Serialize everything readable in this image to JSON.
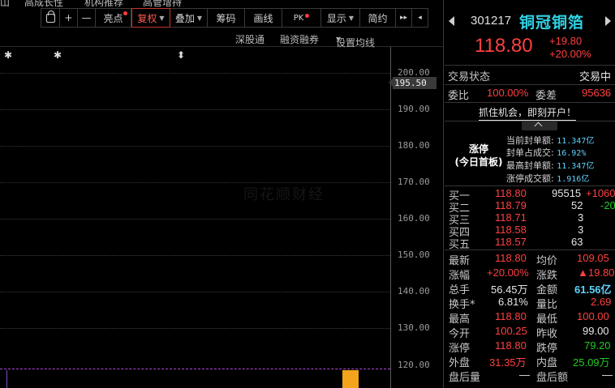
{
  "top_tabs": [
    "山",
    "高成长性",
    "机构推荐",
    "高管增持"
  ],
  "toolbar": {
    "lock_icon": "lock-icon",
    "plus": "+",
    "minus": "—",
    "highlight": "亮点",
    "adjust": "复权",
    "overlay": "叠加",
    "chips": "筹码",
    "draw": "画线",
    "pk": "PK",
    "display": "显示",
    "simple": "简约",
    "expand": "▸▸",
    "collapse": "◂"
  },
  "subbar": {
    "connect": "深股通",
    "margin": "融资融券",
    "ma_settings": "设置均线"
  },
  "chart_markers": [
    "✱",
    "✱",
    "⬍"
  ],
  "price_axis": {
    "ticks": [
      "200.00",
      "190.00",
      "180.00",
      "170.00",
      "160.00",
      "150.00",
      "140.00",
      "130.00",
      "120.00"
    ],
    "current": "195.50"
  },
  "watermark": "同花顺财经",
  "quote": {
    "code": "301217",
    "name": "铜冠铜箔",
    "price": "118.80",
    "change": "+19.80",
    "change_pct": "+20.00%",
    "status_label": "交易状态",
    "status_value": "交易中",
    "weibi_label": "委比",
    "weibi_value": "100.00%",
    "weicha_label": "委差",
    "weicha_value": "95636",
    "promo": "抓住机会，即刻开户！"
  },
  "limit_up": {
    "title": "涨停",
    "subtitle": "(今日首板)",
    "stats": [
      {
        "label": "当前封单额:",
        "value": "11.347亿"
      },
      {
        "label": "封单占成交:",
        "value": "16.92%"
      },
      {
        "label": "最高封单额:",
        "value": "11.347亿"
      },
      {
        "label": "涨停成交额:",
        "value": "1.916亿"
      }
    ]
  },
  "order_book": [
    {
      "label": "买一",
      "price": "118.80",
      "vol": "95515",
      "chg": "+1060"
    },
    {
      "label": "买二",
      "price": "118.79",
      "vol": "52",
      "chg": "-20"
    },
    {
      "label": "买三",
      "price": "118.71",
      "vol": "3",
      "chg": ""
    },
    {
      "label": "买四",
      "price": "118.58",
      "vol": "3",
      "chg": ""
    },
    {
      "label": "买五",
      "price": "118.57",
      "vol": "63",
      "chg": ""
    }
  ],
  "quote_rows": [
    {
      "l1": "最新",
      "v1": "118.80",
      "c1": "red",
      "l2": "均价",
      "v2": "109.05",
      "c2": "red"
    },
    {
      "l1": "涨幅",
      "v1": "+20.00%",
      "c1": "red",
      "l2": "涨跌",
      "v2": "▲19.80",
      "c2": "red"
    },
    {
      "l1": "总手",
      "v1": "56.45万",
      "c1": "white",
      "l2": "金额",
      "v2": "61.56亿",
      "c2": "cyan"
    },
    {
      "l1": "换手*",
      "v1": "6.81%",
      "c1": "white",
      "l2": "量比",
      "v2": "2.69",
      "c2": "red"
    },
    {
      "l1": "最高",
      "v1": "118.80",
      "c1": "red",
      "l2": "最低",
      "v2": "100.00",
      "c2": "red"
    },
    {
      "l1": "今开",
      "v1": "100.25",
      "c1": "red",
      "l2": "昨收",
      "v2": "99.00",
      "c2": "white"
    },
    {
      "l1": "涨停",
      "v1": "118.80",
      "c1": "red",
      "l2": "跌停",
      "v2": "79.20",
      "c2": "green"
    },
    {
      "l1": "外盘",
      "v1": "31.35万",
      "c1": "red",
      "l2": "内盘",
      "v2": "25.09万",
      "c2": "green"
    },
    {
      "l1": "盘后量",
      "v1": "—",
      "c1": "white",
      "l2": "盘后额",
      "v2": "—",
      "c2": "white"
    }
  ],
  "colors": {
    "up": "#ff4040",
    "down": "#22cc22",
    "stock_name": "#2fd3e6",
    "limit_line": "#b04ad6",
    "volume_bar": "#f4a31c"
  }
}
